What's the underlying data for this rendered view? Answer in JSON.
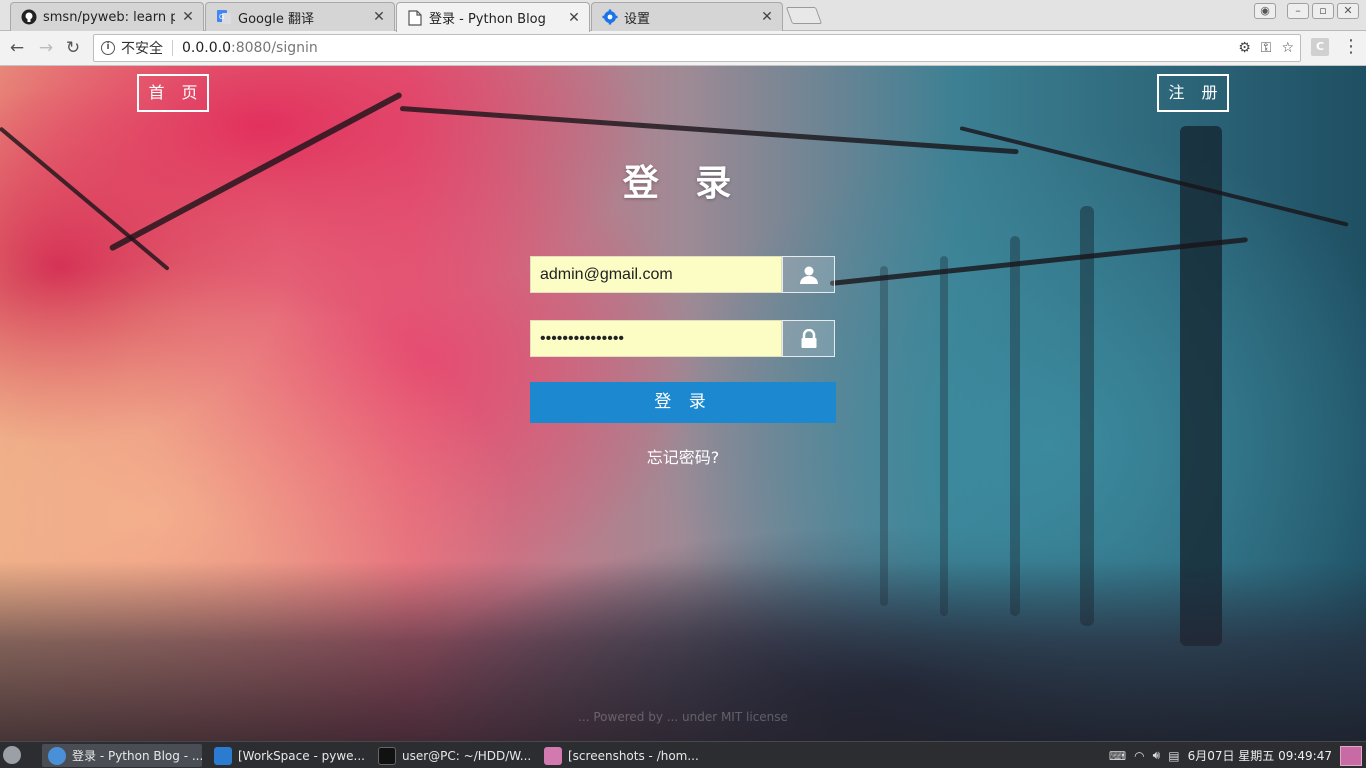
{
  "browser": {
    "tabs": [
      {
        "title": "smsn/pyweb: learn pyth",
        "favicon": "github-icon",
        "active": false
      },
      {
        "title": "Google 翻译",
        "favicon": "google-translate-icon",
        "active": false
      },
      {
        "title": "登录 - Python Blog",
        "favicon": "document-icon",
        "active": true
      },
      {
        "title": "设置",
        "favicon": "gear-icon",
        "active": false
      }
    ],
    "security_label": "不安全",
    "url_host": "0.0.0.0",
    "url_path": ":8080/signin",
    "extension_label": "C"
  },
  "page": {
    "home_button": "首 页",
    "register_button": "注 册",
    "title": "登 录",
    "email_value": "admin@gmail.com",
    "password_value": "•••••••••••••••",
    "submit_label": "登 录",
    "forgot_link": "忘记密码?",
    "footer": "... Powered by ... under MIT license"
  },
  "taskbar": {
    "tasks": [
      {
        "label": "登录 - Python Blog - ...",
        "icon": "chrome-icon",
        "active": true
      },
      {
        "label": "[WorkSpace - pywe...",
        "icon": "vscode-icon",
        "active": false
      },
      {
        "label": "user@PC: ~/HDD/W...",
        "icon": "terminal-icon",
        "active": false
      },
      {
        "label": "[screenshots - /hom...",
        "icon": "folder-icon",
        "active": false
      }
    ],
    "clock": "6月07日 星期五 09:49:47"
  },
  "colors": {
    "accent_blue": "#1b88cf",
    "input_bg": "#fbfdc5",
    "taskbar_bg": "#2b2d30"
  }
}
